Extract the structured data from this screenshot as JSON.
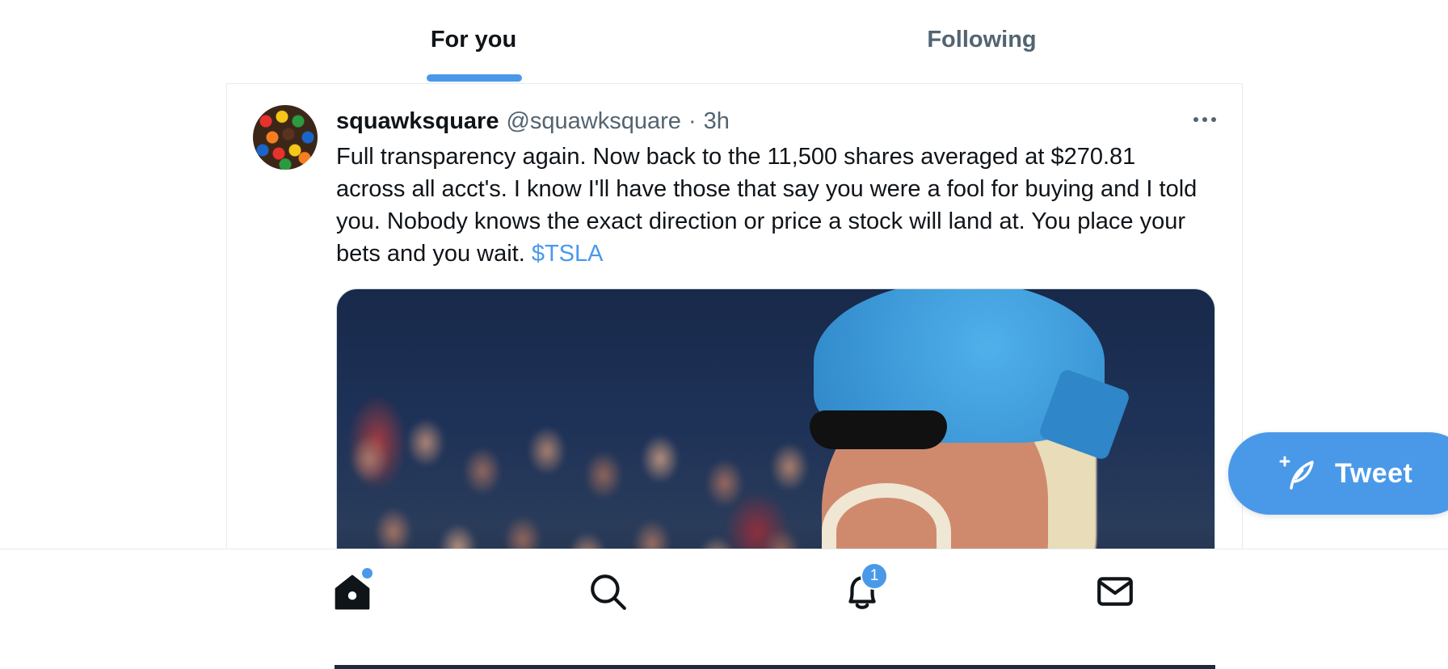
{
  "tabs": {
    "for_you": "For you",
    "following": "Following",
    "active": "For you"
  },
  "tweet": {
    "display_name": "squawksquare",
    "handle": "@squawksquare",
    "separator": "·",
    "time": "3h",
    "text": "Full transparency again. Now back to the 11,500 shares averaged at $270.81 across all acct's. I know I'll have those that say you were a fool for buying and I told you. Nobody knows the exact direction or price a stock will land at. You place your bets and you wait.",
    "cashtag": "$TSLA",
    "avatar_icon": "candy-avatar",
    "more_icon": "more-icon",
    "media": "wrestler-gif-image"
  },
  "fab": {
    "label": "Tweet",
    "icon": "compose-feather-icon"
  },
  "bottom_nav": {
    "items": [
      {
        "name": "home",
        "icon": "home-icon",
        "has_dot": true
      },
      {
        "name": "search",
        "icon": "search-icon"
      },
      {
        "name": "notifications",
        "icon": "bell-icon",
        "badge": "1"
      },
      {
        "name": "messages",
        "icon": "mail-icon"
      }
    ]
  },
  "colors": {
    "accent": "#4a99e9",
    "text_primary": "#0f1419",
    "text_secondary": "#536471",
    "border": "#e6ecf0"
  }
}
